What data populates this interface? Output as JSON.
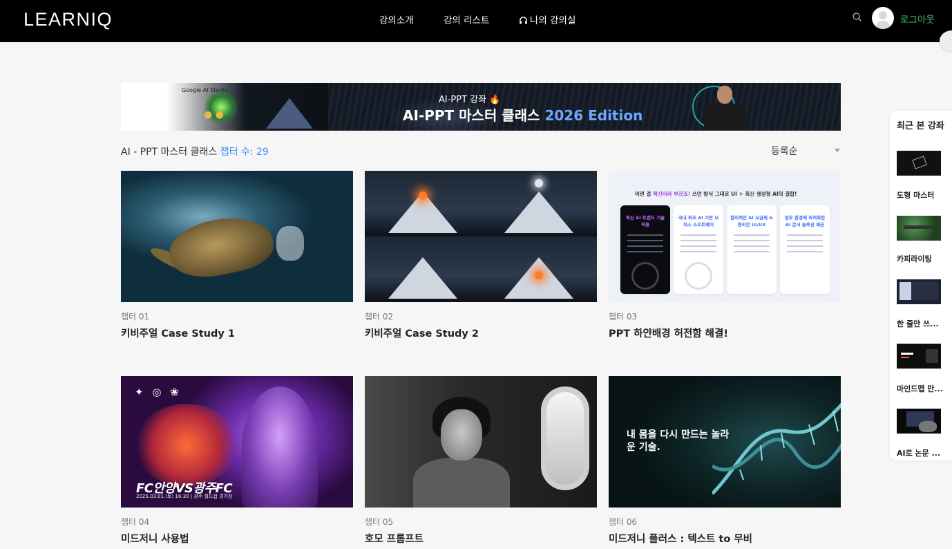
{
  "header": {
    "logo": "LEARNIQ",
    "nav": [
      {
        "label": "강의소개"
      },
      {
        "label": "강의 리스트"
      },
      {
        "label": "나의 강의실",
        "icon": "headphones-icon"
      }
    ],
    "search_icon": "search-icon",
    "avatar_icon": "user-avatar-icon",
    "logout_label": "로그아웃",
    "logout_color": "#3fbf6f"
  },
  "banner": {
    "badge": "Google AI Studio",
    "subtitle": "AI-PPT 강좌 🔥",
    "title_prefix": "AI-PPT 마스터 클래스 ",
    "title_highlight": "2026 Edition",
    "highlight_color": "#6aa9ff"
  },
  "course": {
    "title": "AI - PPT 마스터 클래스",
    "chapter_count_label": "챕터 수: 29",
    "accent_color": "#3d8bff",
    "sort": {
      "selected": "등록순"
    }
  },
  "chapters": [
    {
      "chapter": "챕터 01",
      "title": "키비주얼 Case Study 1"
    },
    {
      "chapter": "챕터 02",
      "title": "키비주얼 Case Study 2"
    },
    {
      "chapter": "챕터 03",
      "title": "PPT 하얀배경 허전함 해결!"
    },
    {
      "chapter": "챕터 04",
      "title": "미드저니 사용법"
    },
    {
      "chapter": "챕터 05",
      "title": "호모 프롬프트"
    },
    {
      "chapter": "챕터 06",
      "title": "미드저니 플러스 : 텍스트 to 무비"
    }
  ],
  "thumb3": {
    "header_pre": "이런 걸 ",
    "header_violet": "혁신이라 부르죠!",
    "header_post": " 쓰던 방식 그대로 UI + 최신 생성형 AI의 결합!",
    "columns": [
      "최신 AI 트렌드 기술 적용",
      "국내 최초 AI 기반 오피스 소프트웨어",
      "합리적인 AI 요금제 & 편리한 UI/UX",
      "업무 환경에 최적화된 AI 문서 솔루션 제공"
    ]
  },
  "thumb4": {
    "headline": "FC안양VS광주FC",
    "date": "2025.03.01.(토) 16:30 | 광주 월드컵 경기장"
  },
  "thumb6": {
    "headline": "내 몸을 다시 만드는 놀라운 기술."
  },
  "recent": {
    "heading": "최근 본 강좌",
    "items": [
      {
        "label": "도형 마스터"
      },
      {
        "label": "카피라이팅"
      },
      {
        "label": "한 줄만 쓰..."
      },
      {
        "label": "마인드맵 만..."
      },
      {
        "label": "AI로 논문 ..."
      }
    ]
  }
}
